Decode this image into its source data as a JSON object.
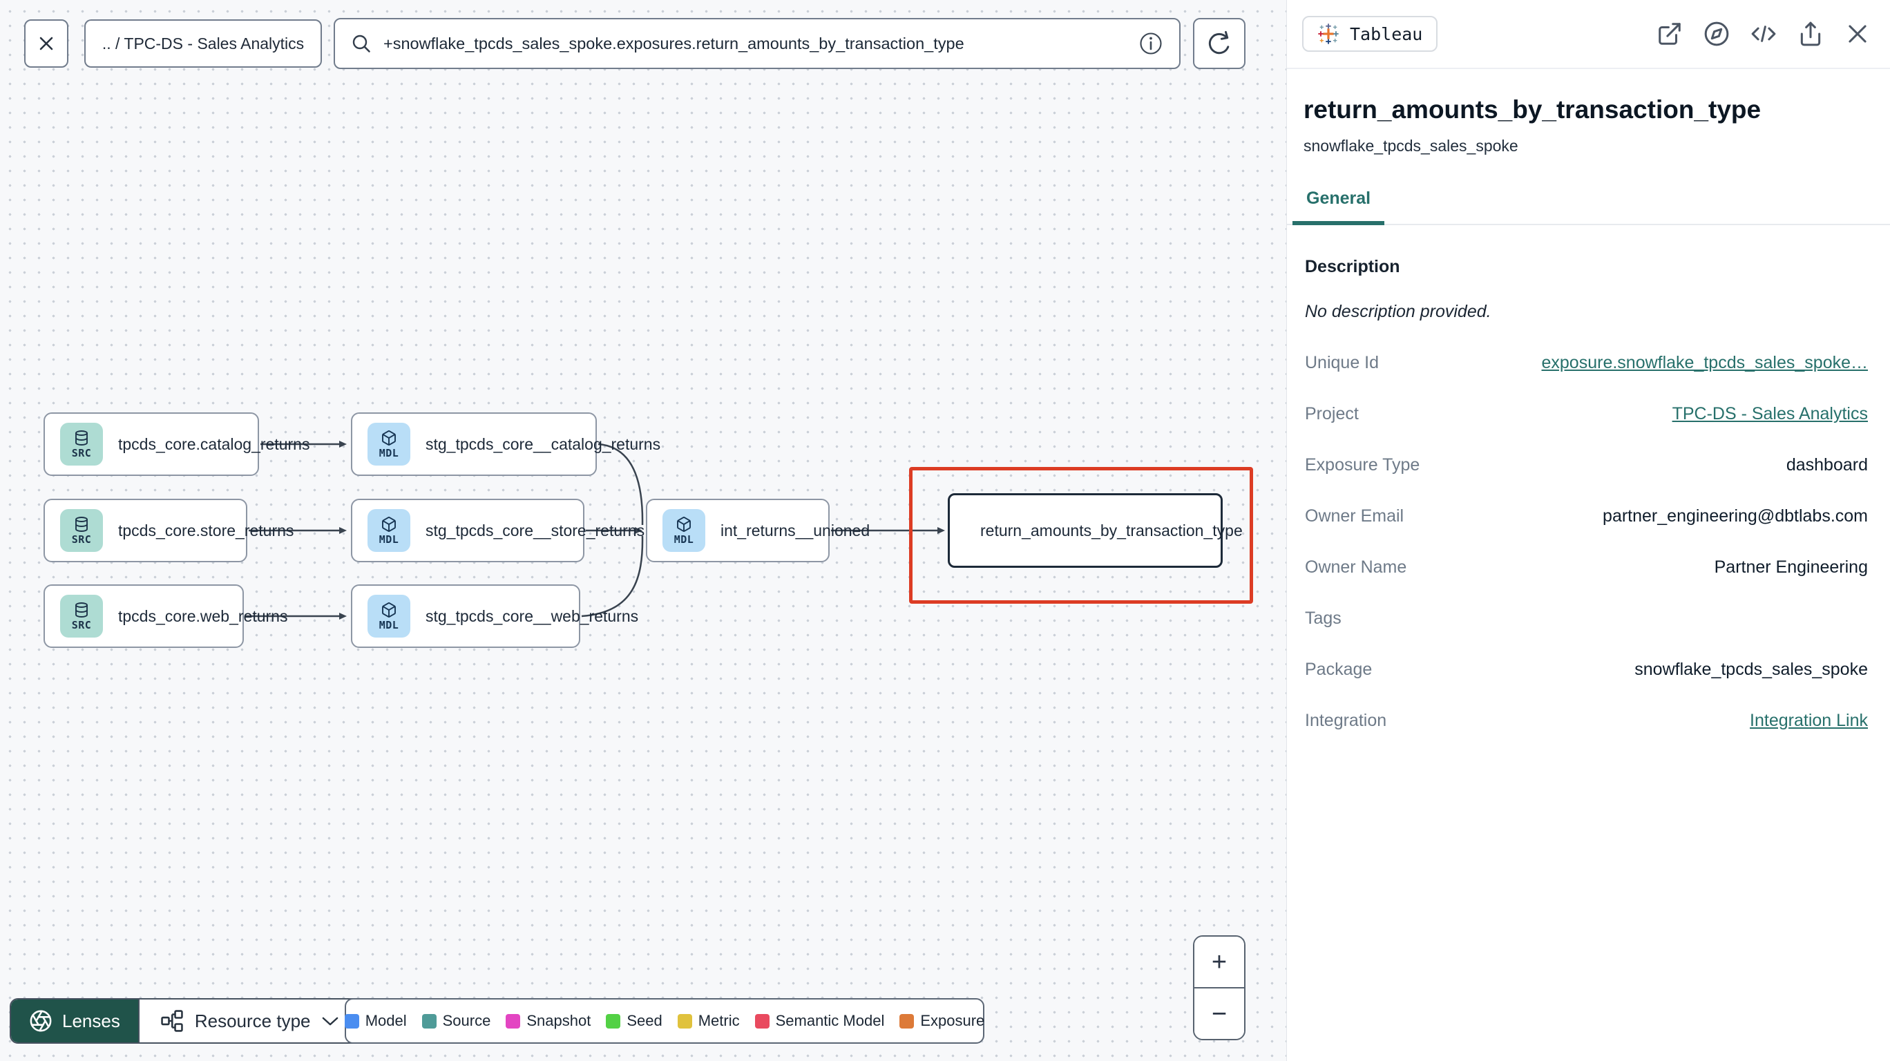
{
  "topbar": {
    "breadcrumb": ".. / TPC-DS - Sales Analytics",
    "search_value": "+snowflake_tpcds_sales_spoke.exposures.return_amounts_by_transaction_type"
  },
  "graph": {
    "nodes": [
      {
        "type": "source",
        "badge": "SRC",
        "label": "tpcds_core.catalog_returns"
      },
      {
        "type": "source",
        "badge": "SRC",
        "label": "tpcds_core.store_returns"
      },
      {
        "type": "source",
        "badge": "SRC",
        "label": "tpcds_core.web_returns"
      },
      {
        "type": "model",
        "badge": "MDL",
        "label": "stg_tpcds_core__catalog_returns"
      },
      {
        "type": "model",
        "badge": "MDL",
        "label": "stg_tpcds_core__store_returns"
      },
      {
        "type": "model",
        "badge": "MDL",
        "label": "stg_tpcds_core__web_returns"
      },
      {
        "type": "model",
        "badge": "MDL",
        "label": "int_returns__unioned"
      },
      {
        "type": "exposure",
        "label": "return_amounts_by_transaction_type"
      }
    ],
    "selection_highlight_color": "#dc3c24"
  },
  "toolbar": {
    "lenses_label": "Lenses",
    "resource_type_label": "Resource type"
  },
  "legend": {
    "items": [
      {
        "label": "Model",
        "color": "#4a8df0"
      },
      {
        "label": "Source",
        "color": "#4f9b98"
      },
      {
        "label": "Snapshot",
        "color": "#e345c2"
      },
      {
        "label": "Seed",
        "color": "#53d145"
      },
      {
        "label": "Metric",
        "color": "#e0c23d"
      },
      {
        "label": "Semantic Model",
        "color": "#e94a5f"
      },
      {
        "label": "Exposure",
        "color": "#dd7a38"
      }
    ]
  },
  "zoom_controls": {
    "zoom_in": "+",
    "zoom_out": "−"
  },
  "panel": {
    "integration_badge": "Tableau",
    "title": "return_amounts_by_transaction_type",
    "subtitle": "snowflake_tpcds_sales_spoke",
    "tab_label": "General",
    "description_label": "Description",
    "description_text": "No description provided.",
    "accent_color": "#27706b",
    "details": [
      {
        "label": "Unique Id",
        "value": "exposure.snowflake_tpcds_sales_spoke…"
      },
      {
        "label": "Project",
        "value": "TPC-DS - Sales Analytics"
      },
      {
        "label": "Exposure Type",
        "value": "dashboard"
      },
      {
        "label": "Owner Email",
        "value": "partner_engineering@dbtlabs.com"
      },
      {
        "label": "Owner Name",
        "value": "Partner Engineering"
      },
      {
        "label": "Tags",
        "value": ""
      },
      {
        "label": "Package",
        "value": "snowflake_tpcds_sales_spoke"
      },
      {
        "label": "Integration",
        "value": "Integration Link"
      }
    ]
  }
}
